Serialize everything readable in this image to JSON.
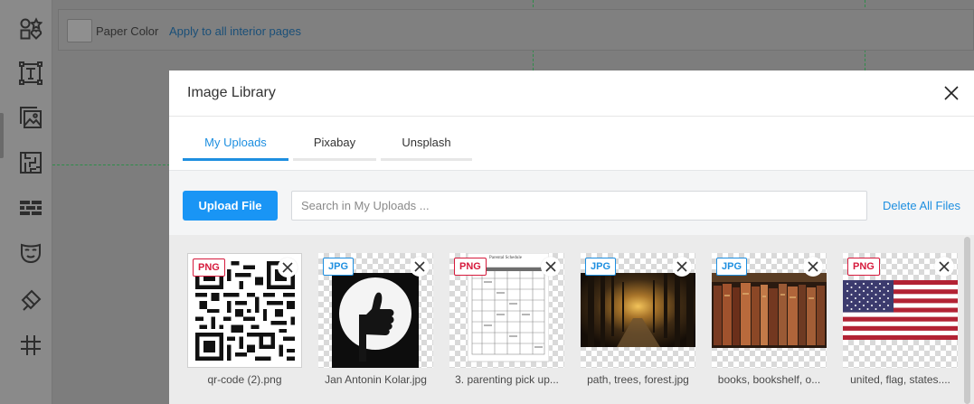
{
  "background": {
    "toolbar": {
      "paper_color_label": "Paper Color",
      "apply_link": "Apply to all interior pages"
    },
    "sidebar_icons": [
      "shapes-icon",
      "text-icon",
      "image-icon",
      "maze-icon",
      "brick-icon",
      "mask-icon",
      "brush-icon",
      "hash-icon"
    ]
  },
  "modal": {
    "title": "Image Library",
    "tabs": [
      {
        "label": "My Uploads",
        "active": true
      },
      {
        "label": "Pixabay",
        "active": false
      },
      {
        "label": "Unsplash",
        "active": false
      }
    ],
    "upload_button": "Upload File",
    "search_placeholder": "Search in My Uploads ...",
    "delete_all": "Delete All Files",
    "files": [
      {
        "name": "qr-code (2).png",
        "type": "PNG",
        "thumb": "qr-code"
      },
      {
        "name": "Jan Antonin Kolar.jpg",
        "type": "JPG",
        "thumb": "thumbs-up"
      },
      {
        "name": "3. parenting pick up...",
        "type": "PNG",
        "thumb": "document",
        "doc_title": "Parental Schedule"
      },
      {
        "name": "path, trees, forest.jpg",
        "type": "JPG",
        "thumb": "forest"
      },
      {
        "name": "books, bookshelf, o...",
        "type": "JPG",
        "thumb": "books"
      },
      {
        "name": "united, flag, states....",
        "type": "PNG",
        "thumb": "us-flag"
      }
    ]
  },
  "colors": {
    "accent": "#1e8fe0",
    "upload_button": "#1995f5",
    "png_badge": "#d61a3c",
    "jpg_badge": "#1e8fe0"
  }
}
